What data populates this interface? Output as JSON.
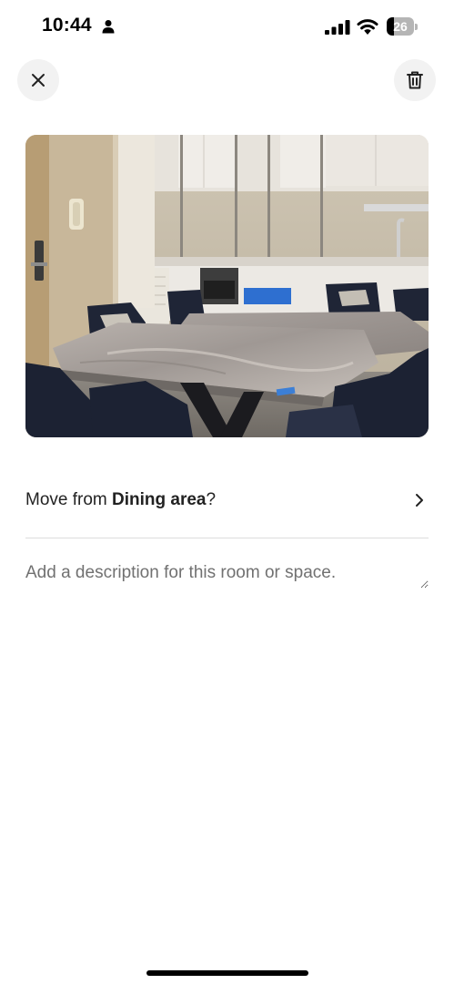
{
  "status_bar": {
    "time": "10:44",
    "battery_level": "26",
    "battery_fraction": 0.26,
    "icons": [
      "person-icon",
      "cellular-signal-icon",
      "wifi-icon",
      "battery-icon"
    ]
  },
  "header": {
    "close_icon": "close-icon",
    "delete_icon": "trash-icon"
  },
  "photo": {
    "subject": "dining-room-photo"
  },
  "move_row": {
    "prefix": "Move from ",
    "room": "Dining area",
    "suffix": "?",
    "icon": "chevron-right-icon"
  },
  "description": {
    "value": "",
    "placeholder": "Add a description for this room or space."
  },
  "colors": {
    "text": "#222222",
    "muted": "#717171",
    "divider": "#dddddd",
    "button_bg": "#f2f2f2"
  }
}
